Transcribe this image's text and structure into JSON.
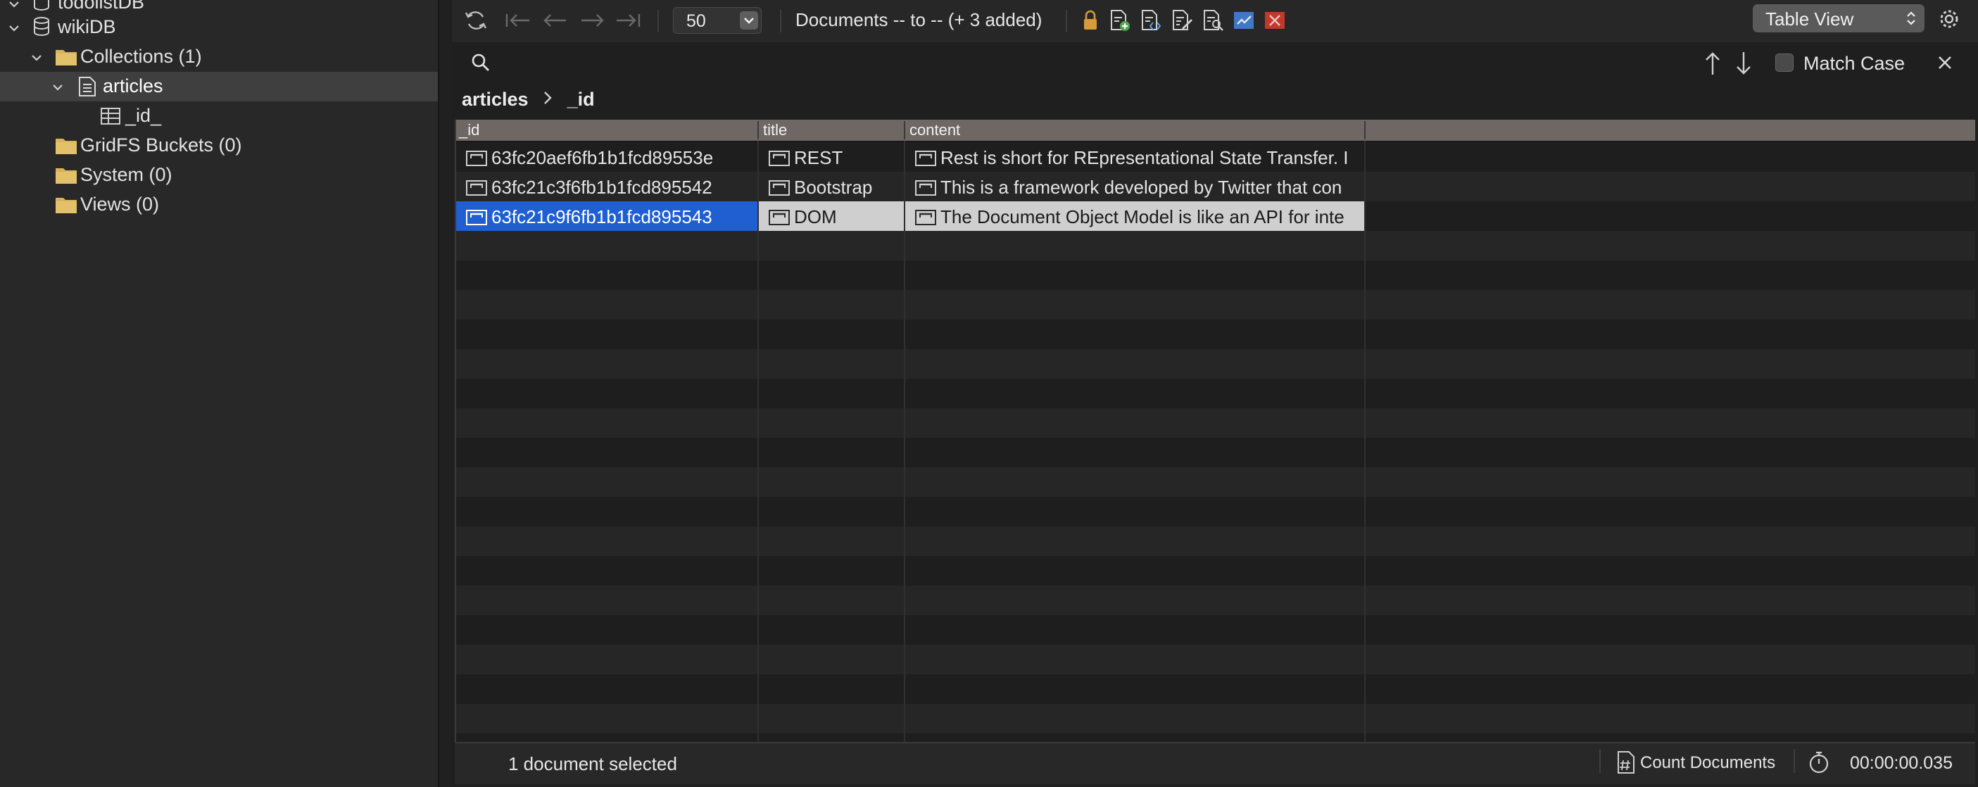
{
  "sidebar": {
    "items": [
      {
        "label": "todolistDB"
      },
      {
        "label": "wikiDB"
      },
      {
        "label": "Collections (1)"
      },
      {
        "label": "articles"
      },
      {
        "label": "_id_"
      },
      {
        "label": "GridFS Buckets (0)"
      },
      {
        "label": "System (0)"
      },
      {
        "label": "Views (0)"
      }
    ]
  },
  "toolbar": {
    "page_size": "50",
    "documents_label": "Documents -- to -- (+ 3 added)",
    "view_mode": "Table View"
  },
  "search": {
    "match_case_label": "Match Case"
  },
  "breadcrumb": {
    "collection": "articles",
    "field": "_id"
  },
  "table": {
    "columns": [
      "_id",
      "title",
      "content"
    ],
    "rows": [
      {
        "id": "63fc20aef6fb1b1fcd89553e",
        "title": "REST",
        "content": "Rest is short for REpresentational State Transfer. I"
      },
      {
        "id": "63fc21c3f6fb1b1fcd895542",
        "title": "Bootstrap",
        "content": "This is a framework developed by Twitter that con"
      },
      {
        "id": "63fc21c9f6fb1b1fcd895543",
        "title": "DOM",
        "content": "The Document Object Model is like an API for inte"
      }
    ],
    "selected_row": 2
  },
  "status": {
    "selection": "1 document selected",
    "count_button": "Count Documents",
    "elapsed": "00:00:00.035"
  },
  "colors": {
    "selection_blue": "#1f5fd1",
    "folder_yellow": "#d8b35a",
    "header_bg": "#6e6764"
  }
}
